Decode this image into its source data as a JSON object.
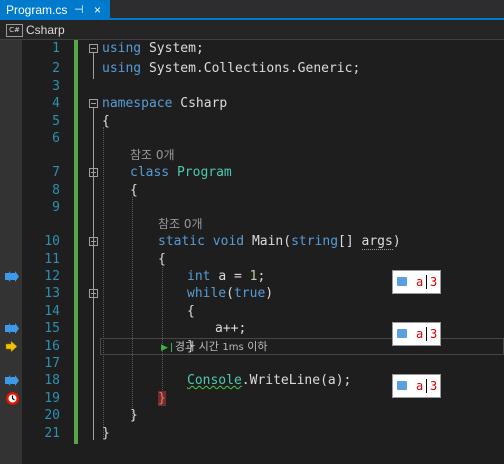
{
  "tab": {
    "filename": "Program.cs",
    "pin_glyph": "⊣",
    "close_glyph": "×"
  },
  "navbar": {
    "badge": "C#",
    "project": "Csharp"
  },
  "lines": {
    "l1": "1",
    "l2": "2",
    "l3": "3",
    "l4": "4",
    "l5": "5",
    "l6": "6",
    "l7": "7",
    "l8": "8",
    "l9": "9",
    "l10": "10",
    "l11": "11",
    "l12": "12",
    "l13": "13",
    "l14": "14",
    "l15": "15",
    "l16": "16",
    "l17": "17",
    "l18": "18",
    "l19": "19",
    "l20": "20",
    "l21": "21"
  },
  "code": {
    "using": "using",
    "system": "System",
    "semi": ";",
    "system_collections": "System.Collections.Generic",
    "namespace_kw": "namespace",
    "namespace_name": "Csharp",
    "open_brace": "{",
    "close_brace": "}",
    "class_kw": "class",
    "class_name": "Program",
    "static_kw": "static",
    "void_kw": "void",
    "main": "Main",
    "paren_open": "(",
    "string_kw": "string",
    "array_brackets": "[]",
    "args": "args",
    "paren_close": ")",
    "int_kw": "int",
    "assign_a": "a = ",
    "one": "1",
    "while_kw": "while",
    "true_kw": "true",
    "increment": "a++;",
    "console": "Console",
    "writeline": ".WriteLine(a);"
  },
  "codelens": {
    "refs_class": "참조 0개",
    "refs_main": "참조 0개"
  },
  "perf_tip": {
    "text_prefix": "경과 시간 ",
    "time": "1ms",
    "text_suffix": " 이하"
  },
  "datatips": [
    {
      "name": "a",
      "value": "3"
    },
    {
      "name": "a",
      "value": "3"
    },
    {
      "name": "a",
      "value": "3"
    }
  ],
  "colors": {
    "keyword": "#569cd6",
    "type": "#4ec9b0",
    "line_number": "#2b91af",
    "accent": "#007acc",
    "breakpoint": "#e51400",
    "execution_arrow": "#f0c400"
  }
}
